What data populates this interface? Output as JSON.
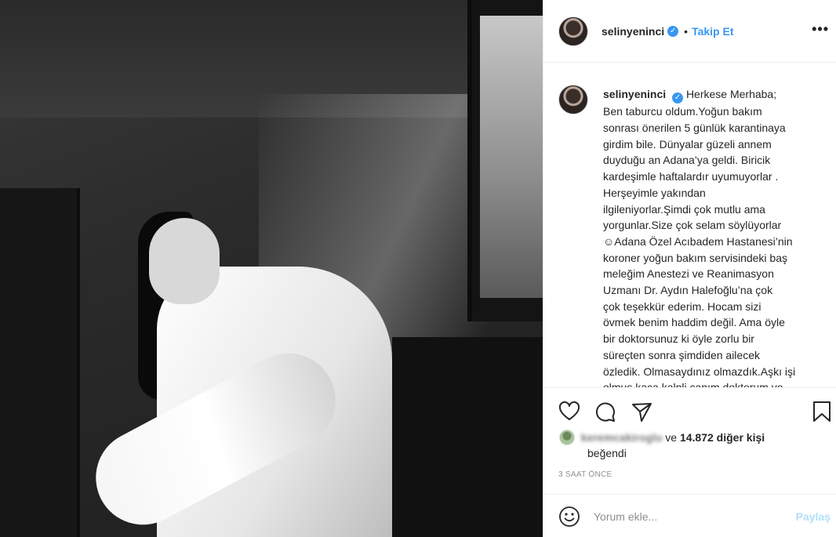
{
  "post": {
    "username": "selinyeninci",
    "follow_label": "Takip Et",
    "separator": "•",
    "more_label": "•••",
    "verified_icon": "check-icon"
  },
  "caption": {
    "username": "selinyeninci",
    "first_line": "Herkese Merhaba;",
    "lines": [
      "Ben taburcu oldum.Yoğun bakım",
      "sonrası önerilen 5 günlük karantinaya",
      "girdim bile. Dünyalar güzeli annem",
      "duyduğu an Adana’ya geldi. Biricik",
      "kardeşimle haftalardır uyumuyorlar .",
      "Herşeyimle yakından",
      "ilgileniyorlar.Şimdi çok mutlu ama",
      "yorgunlar.Size çok selam söylüyorlar",
      "☺Adana Özel Acıbadem Hastanesi’nin",
      "koroner yoğun bakım servisindeki baş",
      "meleğim Anestezi ve Reanimasyon",
      "Uzmanı Dr. Aydın Halefoğlu’na çok",
      "çok teşekkür ederim. Hocam sizi",
      "övmek benim haddim değil. Ama öyle",
      "bir doktorsunuz ki öyle zorlu bir",
      "süreçten sonra şimdiden ailecek",
      "özledik. Olmasaydınız olmazdık.Aşkı işi",
      "olmuş kaça kalpli canım doktorum ve"
    ]
  },
  "actions": {
    "like": "heart-icon",
    "comment": "comment-icon",
    "share": "send-icon",
    "save": "bookmark-icon"
  },
  "likes": {
    "blurred_user": "keremcakiroglu",
    "and_text": "ve",
    "count_text": "14.872 diğer kişi",
    "liked_text": "beğendi"
  },
  "time": "3 SAAT ÖNCE",
  "comment": {
    "placeholder": "Yorum ekle...",
    "submit_label": "Paylaş"
  },
  "colors": {
    "accent": "#3897f0",
    "disabled_accent": "#b2dffc",
    "muted": "#8e8e8e"
  }
}
